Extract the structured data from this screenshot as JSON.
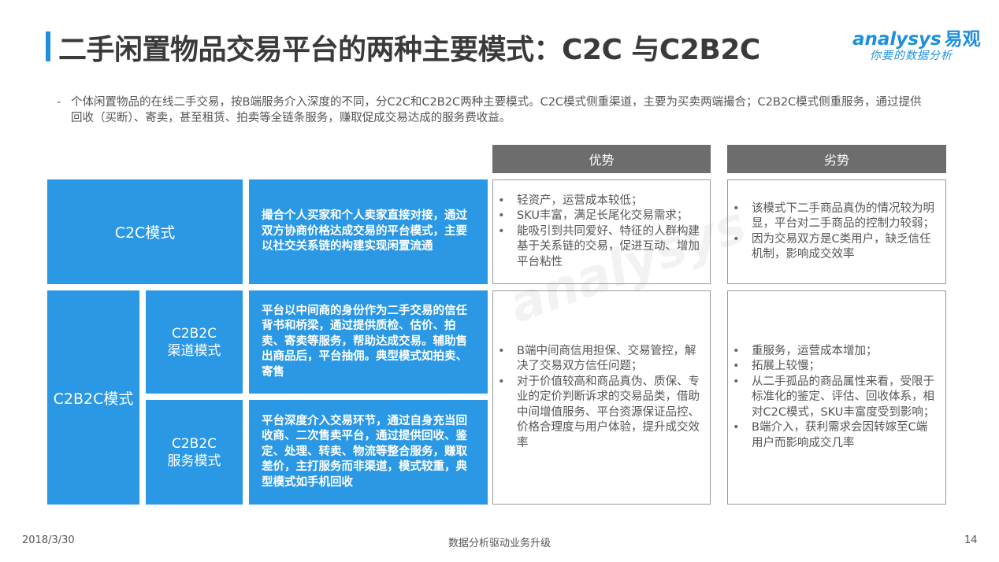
{
  "title": "二手闲置物品交易平台的两种主要模式：C2C 与C2B2C",
  "logo": {
    "brand_en": "analysys",
    "brand_cn": "易观",
    "tagline": "你要的数据分析"
  },
  "intro": {
    "dash": "-",
    "text": "个体闲置物品的在线二手交易，按B端服务介入深度的不同，分C2C和C2B2C两种主要模式。C2C模式侧重渠道，主要为买卖两端撮合；C2B2C模式侧重服务，通过提供回收（买断）、寄卖，甚至租赁、拍卖等全链条服务，赚取促成交易达成的服务费收益。"
  },
  "headers": {
    "advantage": "优势",
    "disadvantage": "劣势"
  },
  "c2c": {
    "label": "C2C模式",
    "desc": "撮合个人买家和个人卖家直接对接，通过双方协商价格达成交易的平台模式，主要以社交关系链的构建实现闲置流通",
    "advantages": [
      "轻资产，运营成本较低；",
      "SKU丰富，满足长尾化交易需求；",
      "能吸引到共同爱好、特征的人群构建基于关系链的交易，促进互动、增加平台粘性"
    ],
    "disadvantages": [
      "该模式下二手商品真伪的情况较为明显，平台对二手商品的控制力较弱；",
      "因为交易双方是C类用户，缺乏信任机制，影响成交效率"
    ]
  },
  "c2b2c": {
    "label": "C2B2C模式",
    "channel": {
      "label_line1": "C2B2C",
      "label_line2": "渠道模式",
      "desc": "平台以中间商的身份作为二手交易的信任背书和桥梁，通过提供质检、估价、拍卖、寄卖等服务，帮助达成交易。辅助售出商品后，平台抽佣。典型模式如拍卖、寄售"
    },
    "service": {
      "label_line1": "C2B2C",
      "label_line2": "服务模式",
      "desc": "平台深度介入交易环节，通过自身充当回收商、二次售卖平台，通过提供回收、鉴定、处理、转卖、物流等整合服务，赚取差价，主打服务而非渠道，模式较重，典型模式如手机回收"
    },
    "advantages": [
      "B端中间商信用担保、交易管控，解决了交易双方信任问题；",
      "对于价值较高和商品真伪、质保、专业的定价判断诉求的交易品类，借助中间增值服务、平台资源保证品控、价格合理度与用户体验，提升成交效率"
    ],
    "disadvantages": [
      "重服务，运营成本增加；",
      "拓展上较慢；",
      "从二手孤品的商品属性来看，受限于标准化的鉴定、评估、回收体系，相对C2C模式，SKU丰富度受到影响；",
      "B端介入，获利需求会因转嫁至C端用户而影响成交几率"
    ]
  },
  "footer": {
    "date": "2018/3/30",
    "center": "数据分析驱动业务升级",
    "page": "14"
  },
  "colors": {
    "accent_blue": "#2a98e4",
    "header_gray": "#6d6d6d",
    "title_bar": "#1f8fdc"
  }
}
